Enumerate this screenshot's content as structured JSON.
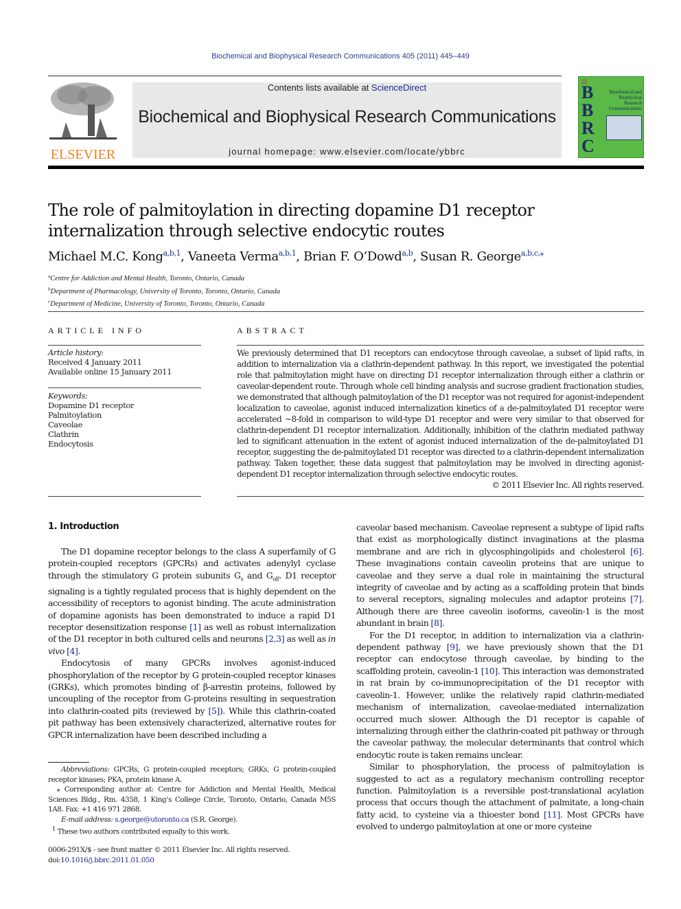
{
  "header": {
    "journal_reference": "Biochemical and Biophysical Research Communications 405 (2011) 445–449",
    "contents_prefix": "Contents lists available at ",
    "contents_link": "ScienceDirect",
    "journal_title": "Biochemical and Biophysical Research Communications",
    "homepage": "journal homepage: www.elsevier.com/locate/ybbrc",
    "publisher_logo_text": "ELSEVIER",
    "cover": {
      "letters": "BBRC",
      "title_lines": [
        "Biochemical and",
        "Biophysical",
        "Research",
        "Communications"
      ],
      "color": "#5bb947"
    }
  },
  "article": {
    "title": "The role of palmitoylation in directing dopamine D1 receptor internalization through selective endocytic routes",
    "authors": [
      {
        "name": "Michael M.C. Kong",
        "marks": "a,b,1"
      },
      {
        "name": "Vaneeta Verma",
        "marks": "a,b,1"
      },
      {
        "name": "Brian F. O’Dowd",
        "marks": "a,b"
      },
      {
        "name": "Susan R. George",
        "marks": "a,b,c,⁎"
      }
    ],
    "affiliations": [
      {
        "mark": "a",
        "text": "Centre for Addiction and Mental Health, Toronto, Ontario, Canada"
      },
      {
        "mark": "b",
        "text": "Department of Pharmacology, University of Toronto, Toronto, Ontario, Canada"
      },
      {
        "mark": "c",
        "text": "Department of Medicine, University of Toronto, Toronto, Ontario, Canada"
      }
    ]
  },
  "article_info": {
    "heading": "ARTICLE INFO",
    "history_label": "Article history:",
    "received": "Received 4 January 2011",
    "available": "Available online 15 January 2011",
    "keywords_label": "Keywords:",
    "keywords": [
      "Dopamine D1 receptor",
      "Palmitoylation",
      "Caveolae",
      "Clathrin",
      "Endocytosis"
    ]
  },
  "abstract": {
    "heading": "ABSTRACT",
    "text": "We previously determined that D1 receptors can endocytose through caveolae, a subset of lipid rafts, in addition to internalization via a clathrin-dependent pathway. In this report, we investigated the potential role that palmitoylation might have on directing D1 receptor internalization through either a clathrin or caveolar-dependent route. Through whole cell binding analysis and sucrose gradient fractionation studies, we demonstrated that although palmitoylation of the D1 receptor was not required for agonist-independent localization to caveolae, agonist induced internalization kinetics of a de-palmitoylated D1 receptor were accelerated ∼8-fold in comparison to wild-type D1 receptor and were very similar to that observed for clathrin-dependent D1 receptor internalization. Additionally, inhibition of the clathrin mediated pathway led to significant attenuation in the extent of agonist induced internalization of the de-palmitoylated D1 receptor, suggesting the de-palmitoylated D1 receptor was directed to a clathrin-dependent internalization pathway. Taken together, these data suggest that palmitoylation may be involved in directing agonist-dependent D1 receptor internalization through selective endocytic routes.",
    "copyright": "© 2011 Elsevier Inc. All rights reserved."
  },
  "body": {
    "section_heading": "1. Introduction",
    "left": {
      "p1": {
        "a": "The D1 dopamine receptor belongs to the class A superfamily of G protein-coupled receptors (GPCRs) and activates adenylyl cyclase through the stimulatory G protein subunits G",
        "sub1": "s",
        "b": " and G",
        "sub2": "olf",
        "c": ". D1 receptor signaling is a tightly regulated process that is highly dependent on the accessibility of receptors to agonist binding. The acute administration of dopamine agonists has been demonstrated to induce a rapid D1 receptor desensitization response ",
        "ref1": "[1]",
        "d": " as well as robust internalization of the D1 receptor in both cultured cells and neurons ",
        "ref2": "[2,3]",
        "e": " as well as ",
        "ital": "in vivo",
        "f": " ",
        "ref3": "[4]",
        "g": "."
      },
      "p2": {
        "a": "Endocytosis of many GPCRs involves agonist-induced phosphorylation of the receptor by G protein-coupled receptor kinases (GRKs), which promotes binding of β-arrestin proteins, followed by uncoupling of the receptor from G-proteins resulting in sequestration into clathrin-coated pits (reviewed by ",
        "ref1": "[5]",
        "b": "). While this clathrin-coated pit pathway has been extensively characterized, alternative routes for GPCR internalization have been described including a"
      }
    },
    "right": {
      "p1": {
        "a": "caveolar based mechanism. Caveolae represent a subtype of lipid rafts that exist as morphologically distinct invaginations at the plasma membrane and are rich in glycosphingolipids and cholesterol ",
        "ref1": "[6]",
        "b": ". These invaginations contain caveolin proteins that are unique to caveolae and they serve a dual role in maintaining the structural integrity of caveolae and by acting as a scaffolding protein that binds to several receptors, signaling molecules and adaptor proteins ",
        "ref2": "[7]",
        "c": ". Although there are three caveolin isoforms, caveolin-1 is the most abundant in brain ",
        "ref3": "[8]",
        "d": "."
      },
      "p2": {
        "a": "For the D1 receptor, in addition to internalization via a clathrin-dependent pathway ",
        "ref1": "[9]",
        "b": ", we have previously shown that the D1 receptor can endocytose through caveolae, by binding to the scaffolding protein, caveolin-1 ",
        "ref2": "[10]",
        "c": ". This interaction was demonstrated in rat brain by co-immunoprecipitation of the D1 receptor with caveolin-1. However, unlike the relatively rapid clathrin-mediated mechanism of internalization, caveolae-mediated internalization occurred much slower. Although the D1 receptor is capable of internalizing through either the clathrin-coated pit pathway or through the caveolar pathway, the molecular determinants that control which endocytic route is taken remains unclear."
      },
      "p3": {
        "a": "Similar to phosphorylation, the process of palmitoylation is suggested to act as a regulatory mechanism controlling receptor function. Palmitoylation is a reversible post-translational acylation process that occurs though the attachment of palmitate, a long-chain fatty acid, to cysteine via a thioester bond ",
        "ref1": "[11]",
        "b": ". Most GPCRs have evolved to undergo palmitoylation at one or more cysteine"
      }
    }
  },
  "footnotes": {
    "abbrev_label": "Abbreviations:",
    "abbrev_text": " GPCRs, G protein-coupled receptors; GRKs, G protein-coupled receptor kinases; PKA, protein kinase A.",
    "corresponding_mark": "⁎",
    "corresponding_text": " Corresponding author at: Centre for Addiction and Mental Health, Medical Sciences Bldg., Rm. 4358, 1 King’s College Circle, Toronto, Ontario, Canada M5S 1A8. Fax: +1 416 971 2868.",
    "email_label": "E-mail address:",
    "email": "s.george@utoronto.ca",
    "email_suffix": " (S.R. George).",
    "equal_mark": "1",
    "equal_text": " These two authors contributed equally to this work."
  },
  "bottom": {
    "issn_line": "0006-291X/$ - see front matter © 2011 Elsevier Inc. All rights reserved.",
    "doi_prefix": "doi:",
    "doi": "10.1016/j.bbrc.2011.01.050"
  }
}
